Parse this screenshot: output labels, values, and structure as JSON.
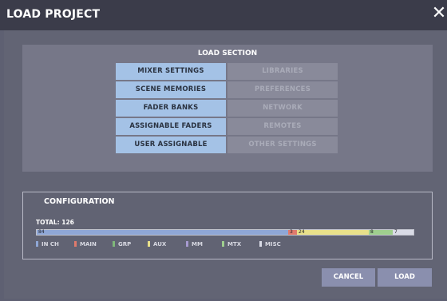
{
  "window": {
    "title": "LOAD PROJECT",
    "close_glyph": "✕"
  },
  "load_section": {
    "title": "LOAD SECTION",
    "left_items": [
      {
        "label": "MIXER SETTINGS"
      },
      {
        "label": "SCENE MEMORIES"
      },
      {
        "label": "FADER BANKS"
      },
      {
        "label": "ASSIGNABLE FADERS"
      },
      {
        "label": "USER ASSIGNABLE"
      }
    ],
    "right_items": [
      {
        "label": "LIBRARIES"
      },
      {
        "label": "PREFERENCES"
      },
      {
        "label": "NETWORK"
      },
      {
        "label": "REMOTES"
      },
      {
        "label": "OTHER SETTINGS"
      }
    ]
  },
  "configuration": {
    "title": "CONFIGURATION",
    "total_label": "TOTAL: 126",
    "total": 126,
    "segments": [
      {
        "name": "IN CH",
        "value": 84,
        "label": "84",
        "color": "#8fa7d6"
      },
      {
        "name": "MAIN",
        "value": 3,
        "label": "3",
        "color": "#e07a6c"
      },
      {
        "name": "AUX",
        "value": 24,
        "label": "24",
        "color": "#e8e08a"
      },
      {
        "name": "MTX",
        "value": 8,
        "label": "8",
        "color": "#9fcf8e"
      },
      {
        "name": "MISC",
        "value": 7,
        "label": "7",
        "color": "#d9dbe6"
      }
    ],
    "legend": [
      {
        "label": "IN CH",
        "color": "#8fa7d6"
      },
      {
        "label": "MAIN",
        "color": "#e07a6c"
      },
      {
        "label": "GRP",
        "color": "#7fb87a"
      },
      {
        "label": "AUX",
        "color": "#e8e08a"
      },
      {
        "label": "MM",
        "color": "#a79ad0"
      },
      {
        "label": "MTX",
        "color": "#9fcf8e"
      },
      {
        "label": "MISC",
        "color": "#d9dbe6"
      }
    ]
  },
  "buttons": {
    "cancel": "CANCEL",
    "load": "LOAD"
  }
}
